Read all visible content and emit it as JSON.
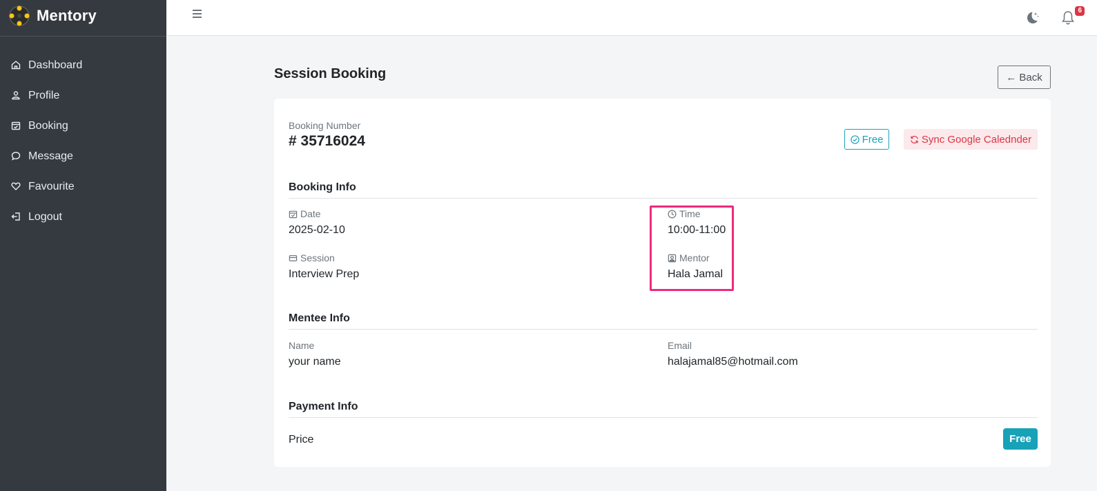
{
  "app": {
    "name": "Mentory"
  },
  "sidebar": {
    "items": [
      {
        "label": "Dashboard",
        "icon": "home-icon"
      },
      {
        "label": "Profile",
        "icon": "user-icon"
      },
      {
        "label": "Booking",
        "icon": "calendar-check-icon"
      },
      {
        "label": "Message",
        "icon": "chat-icon"
      },
      {
        "label": "Favourite",
        "icon": "heart-icon"
      },
      {
        "label": "Logout",
        "icon": "logout-icon"
      }
    ]
  },
  "header": {
    "notification_count": "6"
  },
  "page": {
    "title": "Session Booking",
    "back_label": "← Back"
  },
  "booking": {
    "number_label": "Booking Number",
    "number": "# 35716024",
    "free_badge": "Free",
    "sync_label": "Sync Google Calednder"
  },
  "booking_info": {
    "title": "Booking Info",
    "date_label": "Date",
    "date": "2025-02-10",
    "time_label": "Time",
    "time": "10:00-11:00",
    "session_label": "Session",
    "session": "Interview Prep",
    "mentor_label": "Mentor",
    "mentor": "Hala Jamal"
  },
  "mentee_info": {
    "title": "Mentee Info",
    "name_label": "Name",
    "name": "your name",
    "email_label": "Email",
    "email": "halajamal85@hotmail.com"
  },
  "payment_info": {
    "title": "Payment Info",
    "price_label": "Price",
    "price": "Free"
  },
  "colors": {
    "sidebar": "#343a40",
    "accent": "#17a2b8",
    "danger": "#dc3545",
    "highlight": "#ee2a7b"
  }
}
